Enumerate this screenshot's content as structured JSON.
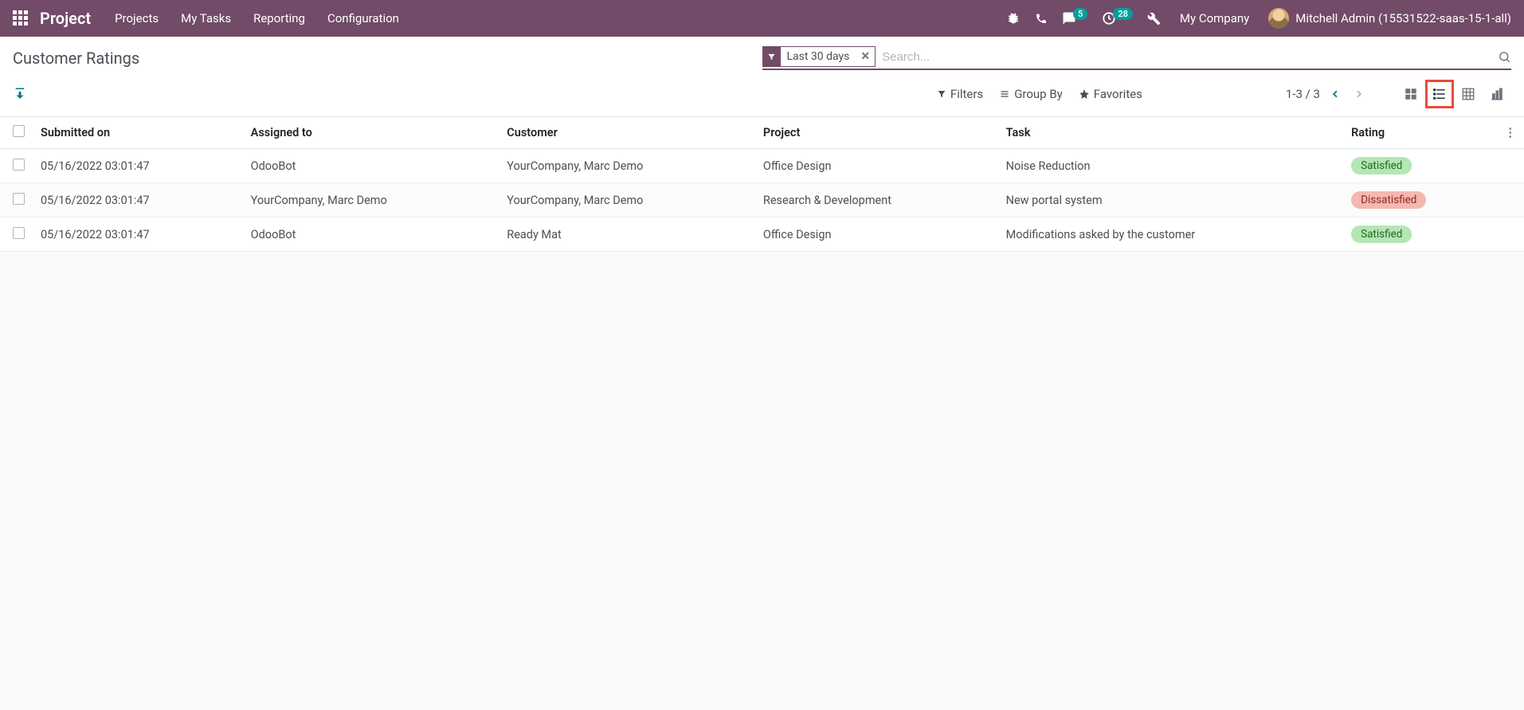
{
  "navbar": {
    "brand": "Project",
    "links": [
      "Projects",
      "My Tasks",
      "Reporting",
      "Configuration"
    ],
    "msg_badge": "5",
    "activity_badge": "28",
    "company": "My Company",
    "user": "Mitchell Admin (15531522-saas-15-1-all)"
  },
  "control": {
    "title": "Customer Ratings",
    "facet": "Last 30 days",
    "search_placeholder": "Search...",
    "filters": "Filters",
    "groupby": "Group By",
    "favorites": "Favorites",
    "pager": "1-3 / 3"
  },
  "table": {
    "headers": {
      "submitted": "Submitted on",
      "assigned": "Assigned to",
      "customer": "Customer",
      "project": "Project",
      "task": "Task",
      "rating": "Rating"
    },
    "rows": [
      {
        "submitted": "05/16/2022 03:01:47",
        "assigned": "OdooBot",
        "customer": "YourCompany, Marc Demo",
        "project": "Office Design",
        "task": "Noise Reduction",
        "rating": "Satisfied",
        "rating_kind": "green"
      },
      {
        "submitted": "05/16/2022 03:01:47",
        "assigned": "YourCompany, Marc Demo",
        "customer": "YourCompany, Marc Demo",
        "project": "Research & Development",
        "task": "New portal system",
        "rating": "Dissatisfied",
        "rating_kind": "red"
      },
      {
        "submitted": "05/16/2022 03:01:47",
        "assigned": "OdooBot",
        "customer": "Ready Mat",
        "project": "Office Design",
        "task": "Modifications asked by the customer",
        "rating": "Satisfied",
        "rating_kind": "green"
      }
    ]
  }
}
